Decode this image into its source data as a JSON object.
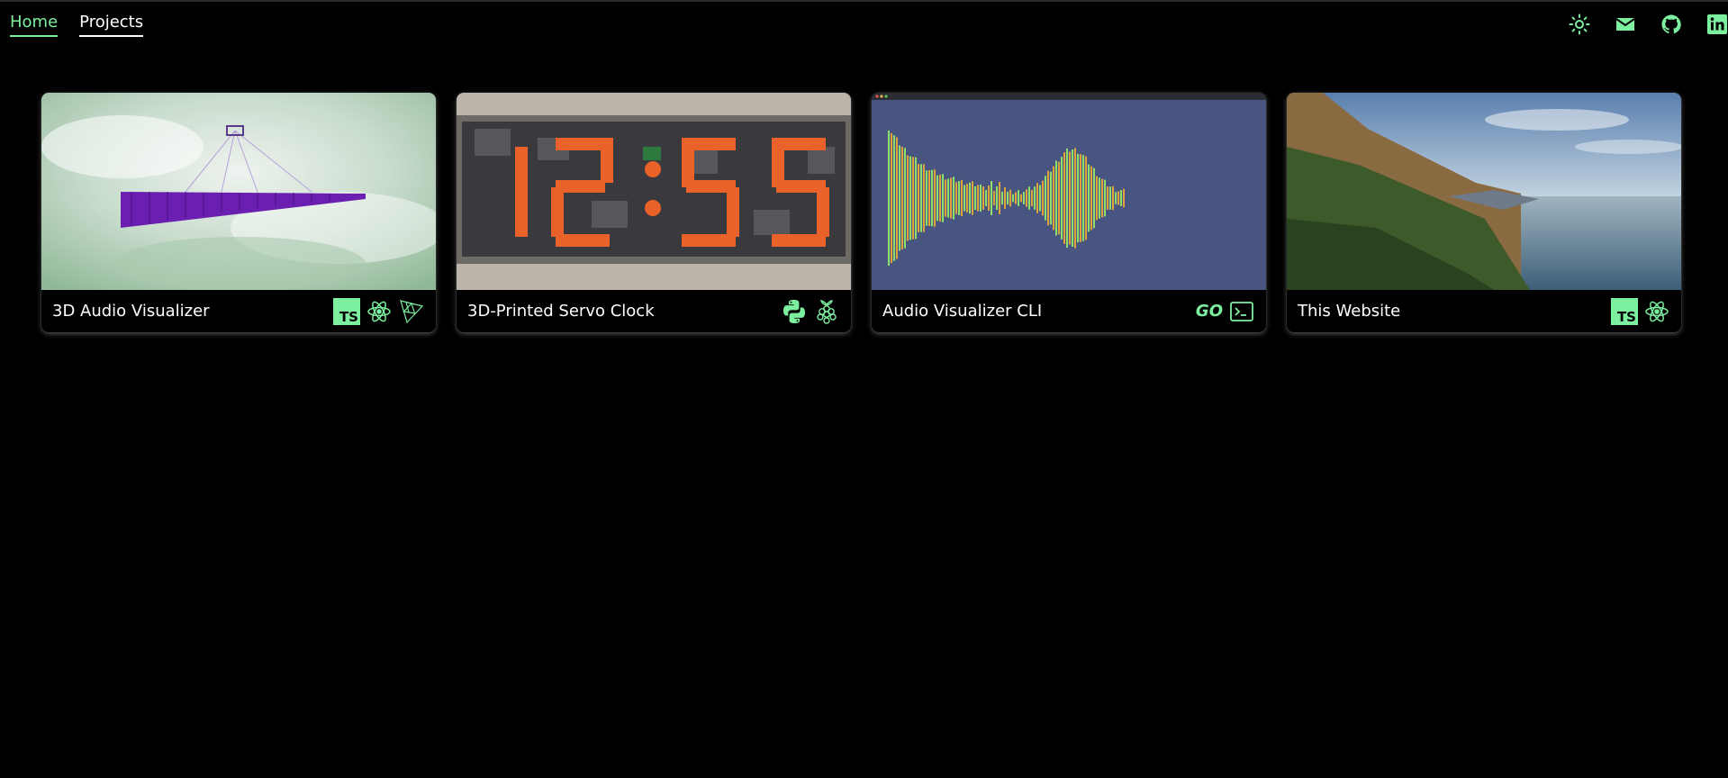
{
  "nav": {
    "home_label": "Home",
    "projects_label": "Projects",
    "active": "Home"
  },
  "header_icons": [
    "sun-icon",
    "mail-icon",
    "github-icon",
    "linkedin-icon"
  ],
  "accent_color": "#7df0a0",
  "projects": [
    {
      "title": "3D Audio Visualizer",
      "tech": [
        "typescript",
        "react",
        "threejs"
      ],
      "tech_labels": [
        "TS"
      ]
    },
    {
      "title": "3D-Printed Servo Clock",
      "tech": [
        "python",
        "raspberry-pi"
      ],
      "clock_display": "12:55"
    },
    {
      "title": "Audio Visualizer CLI",
      "tech": [
        "go",
        "terminal"
      ],
      "tech_labels": [
        "GO"
      ]
    },
    {
      "title": "This Website",
      "tech": [
        "typescript",
        "react"
      ],
      "tech_labels": [
        "TS"
      ]
    }
  ]
}
